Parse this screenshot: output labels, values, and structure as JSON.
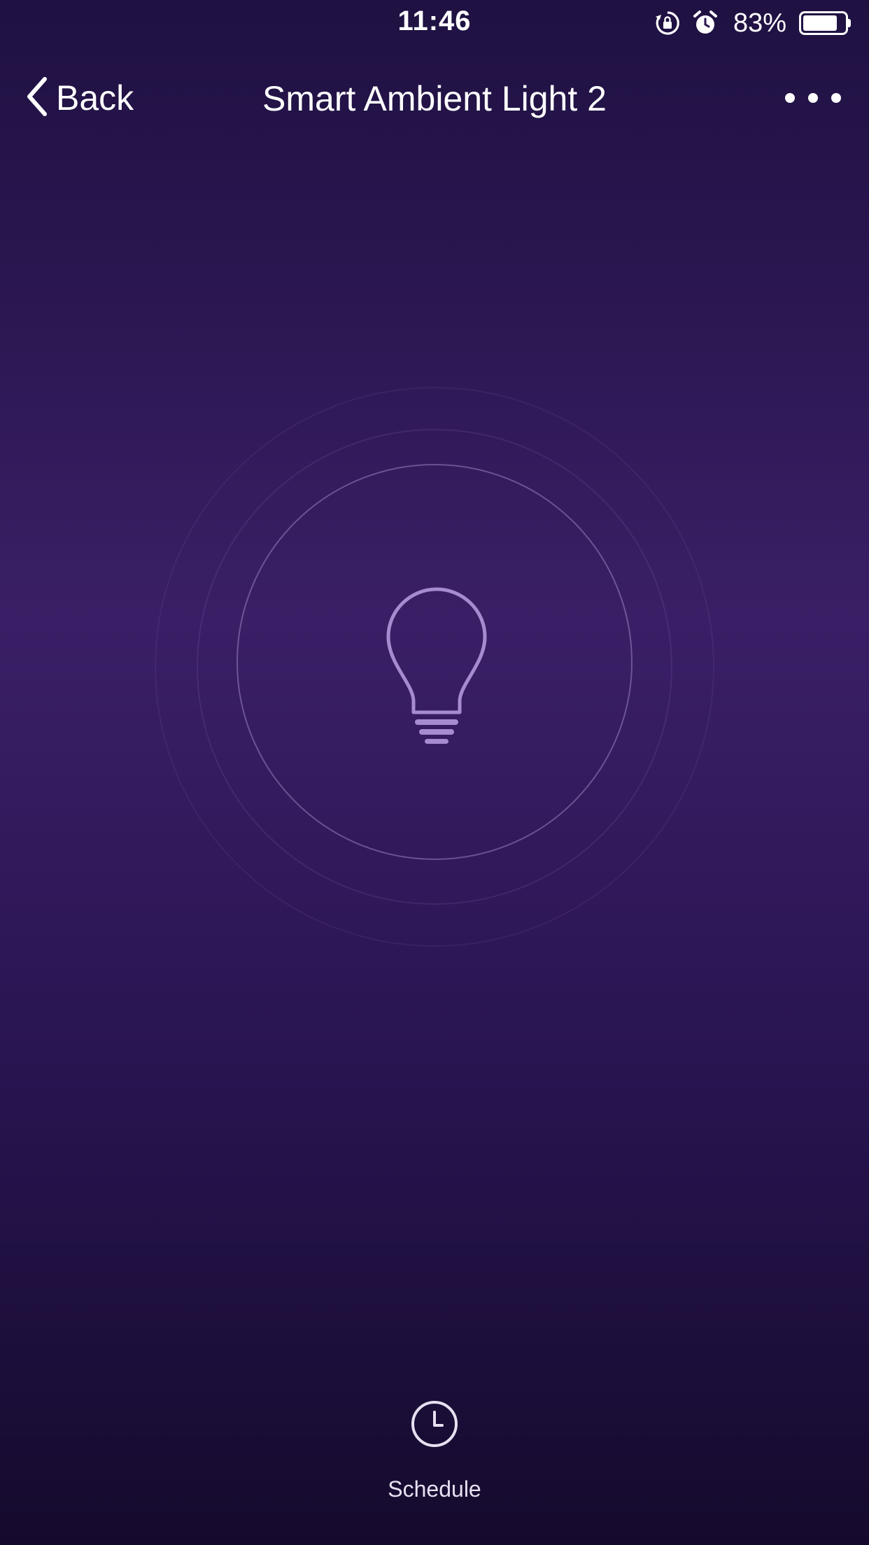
{
  "status_bar": {
    "time": "11:46",
    "battery_percent": "83%",
    "battery_level": 0.83,
    "icons": [
      "rotation-lock-icon",
      "alarm-icon",
      "battery-icon"
    ]
  },
  "nav": {
    "back_label": "Back",
    "title": "Smart Ambient Light 2",
    "more_icon": "more-dots-icon"
  },
  "light": {
    "icon": "lightbulb-icon",
    "accent_color": "#a68bd0"
  },
  "schedule": {
    "label": "Schedule",
    "icon": "clock-icon"
  },
  "colors": {
    "background_top": "#1f1142",
    "background_mid": "#3a1f66",
    "background_bottom": "#150a2d"
  }
}
